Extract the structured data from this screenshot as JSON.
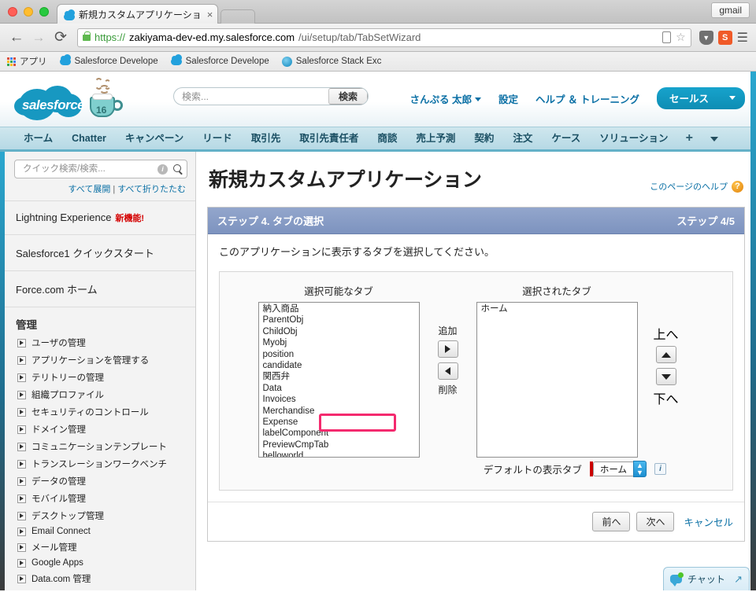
{
  "browser": {
    "tab_title": "新規カスタムアプリケーショ",
    "tab_close": "×",
    "gmail_button": "gmail",
    "url_scheme": "https://",
    "url_host": "zakiyama-dev-ed.my.salesforce.com",
    "url_path": "/ui/setup/tab/TabSetWizard",
    "bookmarks": [
      {
        "label": "アプリ",
        "icon": "apps-grid-icon"
      },
      {
        "label": "Salesforce Develope",
        "icon": "salesforce-cloud-icon"
      },
      {
        "label": "Salesforce Develope",
        "icon": "salesforce-cloud-icon"
      },
      {
        "label": "Salesforce Stack Exc",
        "icon": "stackexchange-icon"
      }
    ]
  },
  "sf_header": {
    "logo_text": "salesforce",
    "mug_number": "16",
    "search_placeholder": "検索...",
    "search_value": "",
    "search_button": "検索",
    "user_name": "さんぷる 太郎",
    "setup_link": "設定",
    "help_link": "ヘルプ ＆ トレーニング",
    "app_selector": "セールス"
  },
  "nav_tabs": [
    "ホーム",
    "Chatter",
    "キャンペーン",
    "リード",
    "取引先",
    "取引先責任者",
    "商談",
    "売上予測",
    "契約",
    "注文",
    "ケース",
    "ソリューション"
  ],
  "nav_extra": {
    "plus": "+",
    "more": "chevron-down-icon"
  },
  "sidebar": {
    "search_placeholder": "クイック検索/検索...",
    "search_value": "",
    "expand_all": "すべて展開",
    "separator": "|",
    "collapse_all": "すべて折りたたむ",
    "top_items": [
      {
        "label": "Lightning Experience",
        "badge": "新機能!"
      },
      {
        "label": "Salesforce1 クイックスタート",
        "badge": ""
      },
      {
        "label": "Force.com ホーム",
        "badge": ""
      }
    ],
    "section_title": "管理",
    "items": [
      "ユーザの管理",
      "アプリケーションを管理する",
      "テリトリーの管理",
      "組織プロファイル",
      "セキュリティのコントロール",
      "ドメイン管理",
      "コミュニケーションテンプレート",
      "トランスレーションワークベンチ",
      "データの管理",
      "モバイル管理",
      "デスクトップ管理",
      "Email Connect",
      "メール管理",
      "Google Apps",
      "Data.com 管理"
    ]
  },
  "main": {
    "page_title": "新規カスタムアプリケーション",
    "help_link": "このページのヘルプ",
    "help_icon": "question-mark-icon",
    "step_title": "ステップ 4. タブの選択",
    "step_counter": "ステップ 4/5",
    "intro": "このアプリケーションに表示するタブを選択してください。",
    "available_label": "選択可能なタブ",
    "selected_label": "選択されたタブ",
    "available_tabs": [
      "納入商品",
      "ParentObj",
      "ChildObj",
      "Myobj",
      "position",
      "candidate",
      "関西弁",
      "Data",
      "Invoices",
      "Merchandise",
      "Expense",
      "labelComponent",
      "PreviewCmpTab",
      "helloworld"
    ],
    "selected_tabs": [
      "ホーム"
    ],
    "add_label": "追加",
    "remove_label": "削除",
    "up_label": "上へ",
    "down_label": "下へ",
    "default_tab_label": "デフォルトの表示タブ",
    "default_tab_value": "ホーム",
    "info_icon": "info-icon",
    "prev_button": "前へ",
    "next_button": "次へ",
    "cancel_button": "キャンセル",
    "highlight_color": "#f42a6e",
    "highlighted_item": "PreviewCmpTab"
  },
  "chat": {
    "label": "チャット",
    "status": "online",
    "expand_icon": "expand-arrow-icon"
  }
}
